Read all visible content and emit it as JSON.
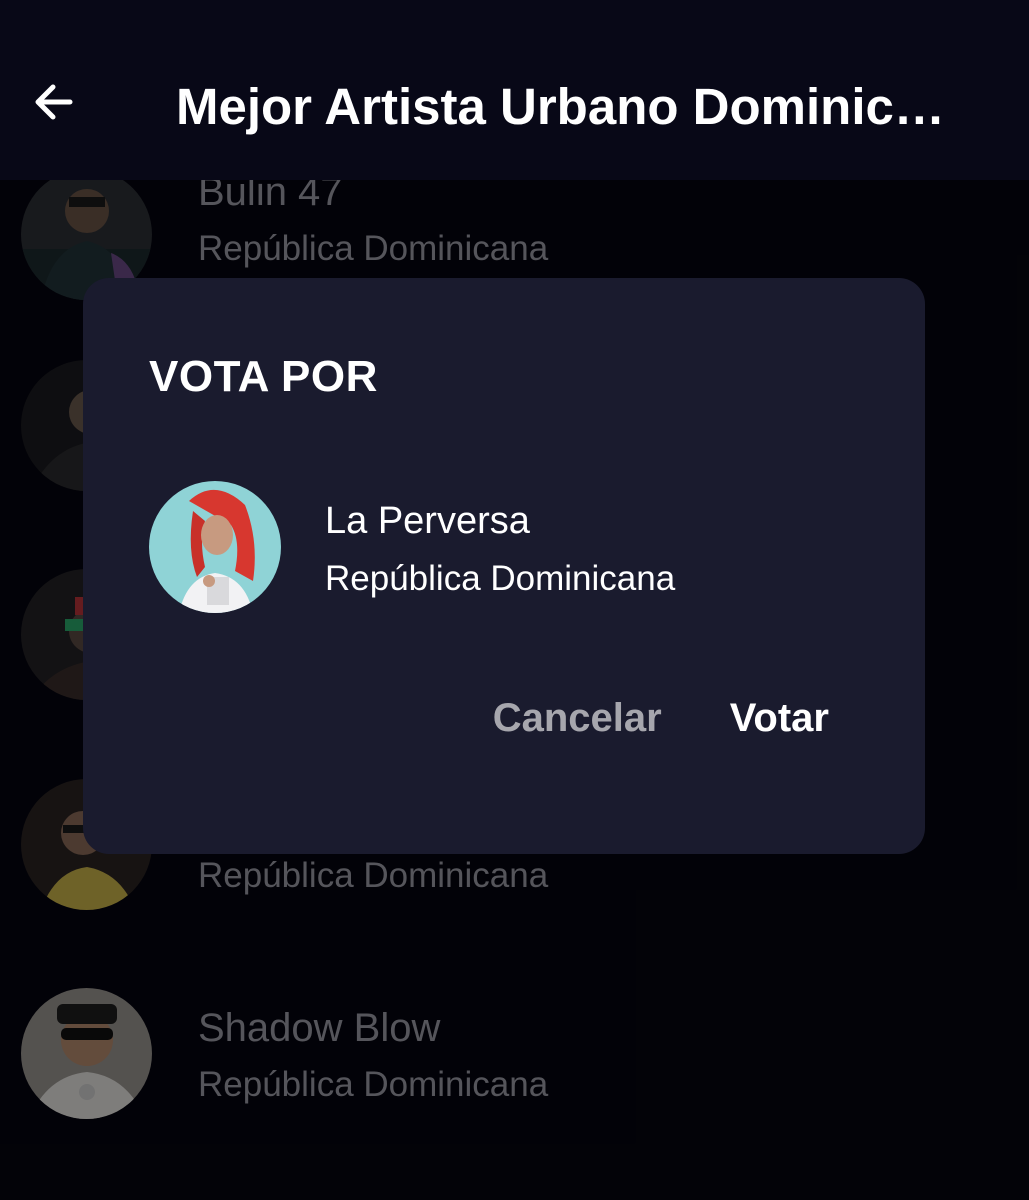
{
  "app_bar": {
    "title": "Mejor Artista Urbano Dominicano",
    "back_icon": "arrow-left-icon"
  },
  "list": {
    "items": [
      {
        "name": "Bulin 47",
        "country": "República Dominicana"
      },
      {
        "name": "",
        "country": ""
      },
      {
        "name": "",
        "country": ""
      },
      {
        "name": "",
        "country": "República Dominicana"
      },
      {
        "name": "Shadow Blow",
        "country": "República Dominicana"
      }
    ]
  },
  "dialog": {
    "title": "VOTA POR",
    "artist_name": "La Perversa",
    "artist_country": "República Dominicana",
    "cancel_label": "Cancelar",
    "vote_label": "Votar"
  },
  "colors": {
    "background": "#05050f",
    "app_bar": "#080817",
    "dialog": "#1a1b2e",
    "text_primary": "#ffffff",
    "text_muted": "#9c9ca6"
  }
}
